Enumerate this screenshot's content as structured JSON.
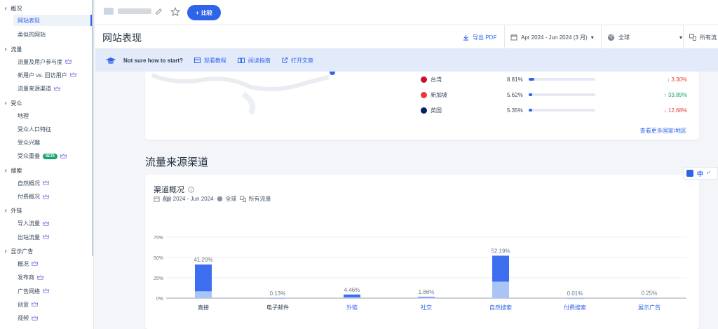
{
  "sidebar": {
    "sections": [
      {
        "label": "概况",
        "items": [
          {
            "label": "网站表现",
            "active": true
          },
          {
            "label": "类似的网站"
          }
        ]
      },
      {
        "label": "流量",
        "items": [
          {
            "label": "流量及用户参与度",
            "crown": true
          },
          {
            "label": "新用户 vs. 回访用户",
            "crown": true
          },
          {
            "label": "流量来源渠道",
            "crown": true
          }
        ]
      },
      {
        "label": "受众",
        "items": [
          {
            "label": "地理"
          },
          {
            "label": "受众人口特征"
          },
          {
            "label": "受众兴趣"
          },
          {
            "label": "受众重叠",
            "badge": "BETA",
            "crown": true
          }
        ]
      },
      {
        "label": "搜索",
        "items": [
          {
            "label": "自然概况",
            "crown": true
          },
          {
            "label": "付费概况",
            "crown": true
          }
        ]
      },
      {
        "label": "外链",
        "items": [
          {
            "label": "导入流量",
            "crown": true
          },
          {
            "label": "出站流量",
            "crown": true
          }
        ]
      },
      {
        "label": "显示广告",
        "items": [
          {
            "label": "概况",
            "crown": true
          },
          {
            "label": "发布商",
            "crown": true
          },
          {
            "label": "广告网络",
            "crown": true
          },
          {
            "label": "创意",
            "crown": true
          },
          {
            "label": "视频",
            "crown": true
          }
        ]
      }
    ]
  },
  "topbar": {
    "compare_label": "比较",
    "compare_icon": "+"
  },
  "header": {
    "title": "网站表现",
    "export_label": "导出 PDF",
    "date_range": "Apr 2024 - Jun 2024 (3 月)",
    "region": "全球",
    "traffic_type": "所有流"
  },
  "banner": {
    "prompt": "Not sure how to start?",
    "links": [
      {
        "label": "观看教程",
        "icon": "video-icon"
      },
      {
        "label": "阅读指南",
        "icon": "book-icon"
      },
      {
        "label": "打开文章",
        "icon": "external-link-icon"
      }
    ]
  },
  "countries": {
    "rows": [
      {
        "name": "台湾",
        "share": "8.81%",
        "share_value": 8.81,
        "change": "↓ 3.30%",
        "direction": "down",
        "flag_color": "#c8102e"
      },
      {
        "name": "新加坡",
        "share": "5.62%",
        "share_value": 5.62,
        "change": "↑ 33.89%",
        "direction": "up",
        "flag_color": "#ef3340"
      },
      {
        "name": "英国",
        "share": "5.35%",
        "share_value": 5.35,
        "change": "↓ 12.68%",
        "direction": "down",
        "flag_color": "#012169"
      }
    ],
    "more_link": "查看更多国家/地区"
  },
  "section_title": "流量来源渠道",
  "channels_card": {
    "title": "渠道概况",
    "date_highlight": "Apr",
    "date_rest": " 2024 - Jun 2024",
    "region": "全球",
    "traffic": "所有流量"
  },
  "float_tool": {
    "label": "中"
  },
  "colors": {
    "accent": "#2e64e8",
    "bar_dark": "#3d6ef0",
    "bar_light": "#a9c4f7",
    "down": "#e1413b",
    "up": "#1aa36f"
  },
  "chart_data": {
    "type": "bar",
    "categories": [
      "直接",
      "电子邮件",
      "外链",
      "社交",
      "自然搜索",
      "付费搜索",
      "展示广告"
    ],
    "values": [
      41.29,
      0.13,
      4.46,
      1.66,
      52.19,
      0.01,
      0.25
    ],
    "labels": [
      "41.29%",
      "0.13%",
      "4.46%",
      "1.66%",
      "52.19%",
      "0.01%",
      "0.25%"
    ],
    "stacked_split": [
      {
        "dark": 33.0,
        "light": 8.29
      },
      {
        "dark": 0.05,
        "light": 0.08
      },
      {
        "dark": 3.5,
        "light": 0.96
      },
      {
        "dark": 0.9,
        "light": 0.76
      },
      {
        "dark": 32.0,
        "light": 20.19
      },
      {
        "dark": 0.0,
        "light": 0.01
      },
      {
        "dark": 0.1,
        "light": 0.15
      }
    ],
    "yticks": [
      "75%",
      "50%",
      "25%",
      "0%"
    ],
    "ytick_values": [
      75,
      50,
      25,
      0
    ],
    "ylim": [
      0,
      75
    ],
    "grid": true
  }
}
